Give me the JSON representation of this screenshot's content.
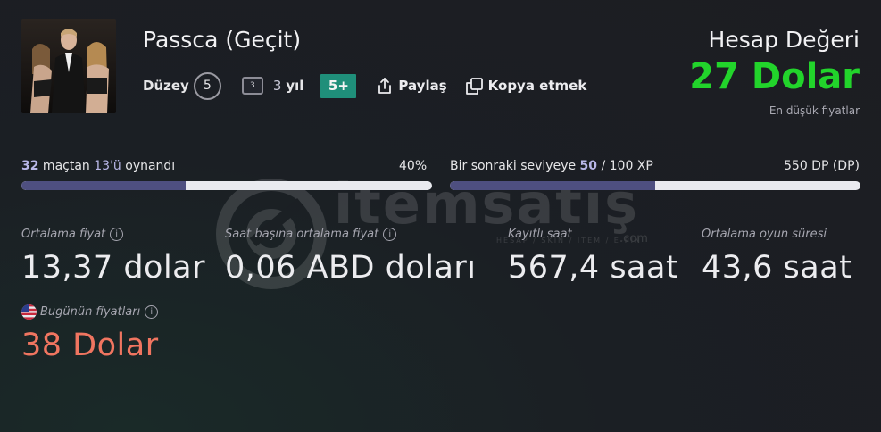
{
  "watermark": {
    "text": "itemsatış",
    "sub": "HESAP / SKIN / ITEM / E-PIN",
    "com": ".com"
  },
  "profile": {
    "name": "Passca (Geçit)",
    "level_label": "Düzey",
    "level": "5",
    "years_badge": "3",
    "years_num": "3",
    "years_label": "yıl",
    "badge": "5+",
    "share_label": "Paylaş",
    "copy_label": "Kopya etmek"
  },
  "account_value": {
    "title": "Hesap Değeri",
    "value": "27 Dolar",
    "subtitle": "En düşük fiyatlar",
    "color": "#22d42b"
  },
  "progress": {
    "matches": {
      "played": "32",
      "text1": " maçtan ",
      "won": "13'ü",
      "text2": " oynandı",
      "percent_label": "40%",
      "fraction": 0.4
    },
    "level": {
      "text1": "Bir sonraki seviyeye ",
      "current": "50",
      "text2": " / 100 XP",
      "right_label": "550 DP (DP)",
      "fraction": 0.5
    }
  },
  "stats": [
    {
      "label": "Ortalama fiyat",
      "value": "13,37 dolar",
      "info": true
    },
    {
      "label": "Saat başına ortalama fiyat",
      "value": "0,06 ABD doları",
      "info": true
    },
    {
      "label": "Kayıtlı saat",
      "value": "567,4 saat",
      "info": false
    },
    {
      "label": "Ortalama oyun süresi",
      "value": "43,6 saat",
      "info": false
    }
  ],
  "today": {
    "label": "Bugünün fiyatları",
    "value": "38 Dolar",
    "color": "#f07560"
  },
  "icons": {
    "share": "share-icon",
    "copy": "copy-icon",
    "info": "info-icon",
    "flag": "us-flag-icon"
  }
}
